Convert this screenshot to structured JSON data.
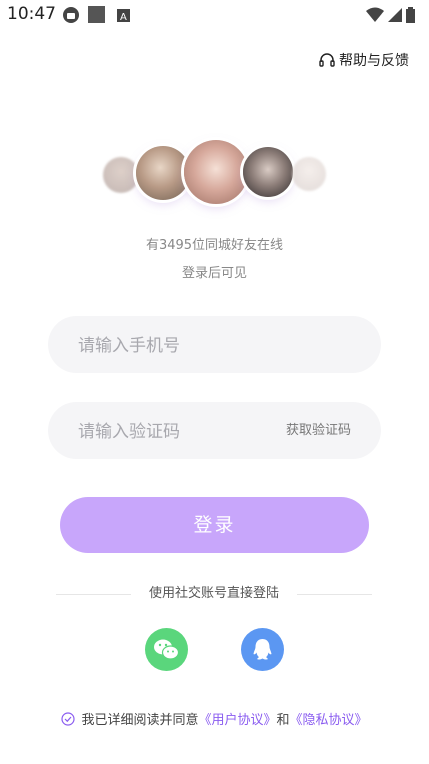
{
  "status_bar": {
    "time": "10:47"
  },
  "help": {
    "label": "帮助与反馈"
  },
  "promo": {
    "online_text": "有3495位同城好友在线",
    "hint": "登录后可见"
  },
  "phone": {
    "placeholder": "请输入手机号"
  },
  "code": {
    "placeholder": "请输入验证码",
    "get_code": "获取验证码"
  },
  "login": {
    "label": "登录"
  },
  "social": {
    "title": "使用社交账号直接登陆",
    "wechat_icon": "wechat-icon",
    "qq_icon": "qq-icon"
  },
  "agreement": {
    "prefix": "我已详细阅读并同意",
    "user_agreement": "《用户协议》",
    "and": "和",
    "privacy": "《隐私协议》"
  },
  "colors": {
    "accent": "#c8a6fb",
    "link": "#8a5cf0",
    "wechat": "#5ad67c",
    "qq": "#5b97f2"
  }
}
